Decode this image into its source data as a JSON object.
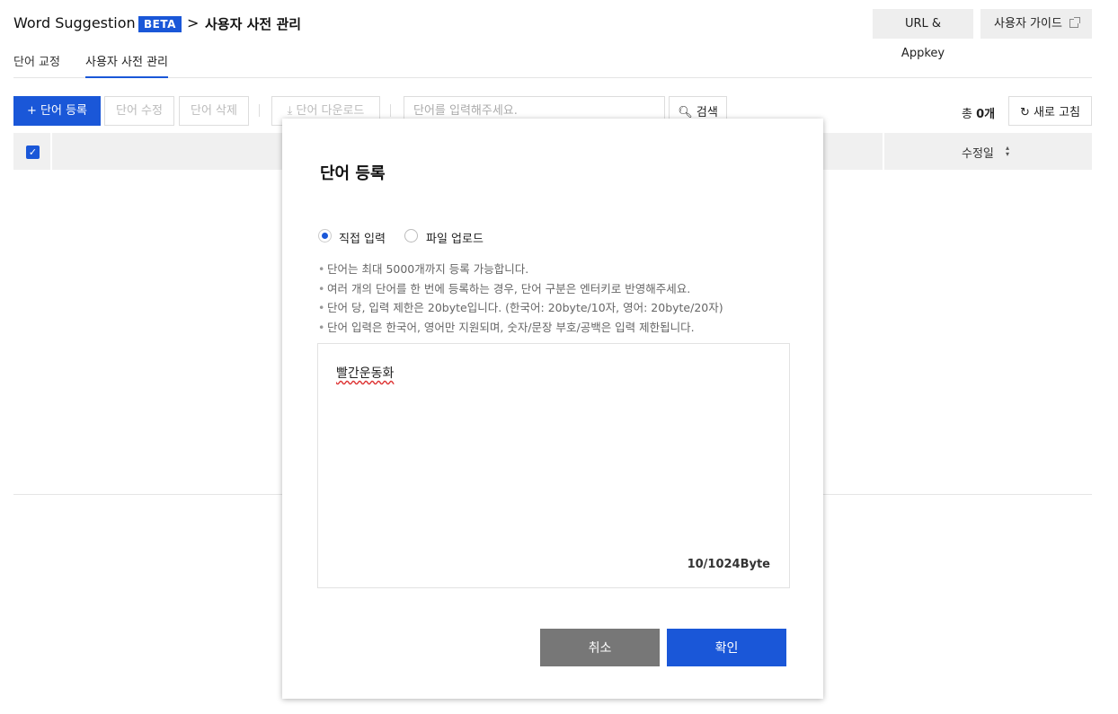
{
  "header": {
    "title": "Word Suggestion",
    "badge": "BETA",
    "separator": ">",
    "breadcrumb": "사용자 사전 관리",
    "url_button": "URL & Appkey",
    "guide_button": "사용자 가이드"
  },
  "tabs": [
    {
      "label": "단어 교정",
      "active": false
    },
    {
      "label": "사용자 사전 관리",
      "active": true
    }
  ],
  "toolbar": {
    "add_label": "+  단어 등록",
    "edit_label": "단어 수정",
    "delete_label": "단어 삭제",
    "download_label": "단어 다운로드",
    "search_placeholder": "단어를 입력해주세요.",
    "search_label": "검색",
    "total_prefix": "총",
    "total_count": "0개",
    "refresh_label": "새로 고침"
  },
  "table": {
    "header_checkbox": "✓",
    "date_column": "수정일",
    "sort_icon": "sort-icon"
  },
  "modal": {
    "title": "단어 등록",
    "options": [
      {
        "label": "직접 입력",
        "selected": true
      },
      {
        "label": "파일 업로드",
        "selected": false
      }
    ],
    "notes": [
      "단어는 최대 5000개까지 등록 가능합니다.",
      "여러 개의 단어를 한 번에 등록하는 경우, 단어 구분은 엔터키로 반영해주세요.",
      "단어 당, 입력 제한은 20byte입니다. (한국어: 20byte/10자, 영어: 20byte/20자)",
      "단어 입력은 한국어, 영어만 지원되며, 숫자/문장 부호/공백은 입력 제한됩니다."
    ],
    "input_value": "빨간운동화",
    "byte_counter": "10/1024Byte",
    "cancel_label": "취소",
    "confirm_label": "확인"
  },
  "colors": {
    "primary": "#1a57d8",
    "cancel": "#777777",
    "table_header_bg": "#f0f0f0"
  }
}
